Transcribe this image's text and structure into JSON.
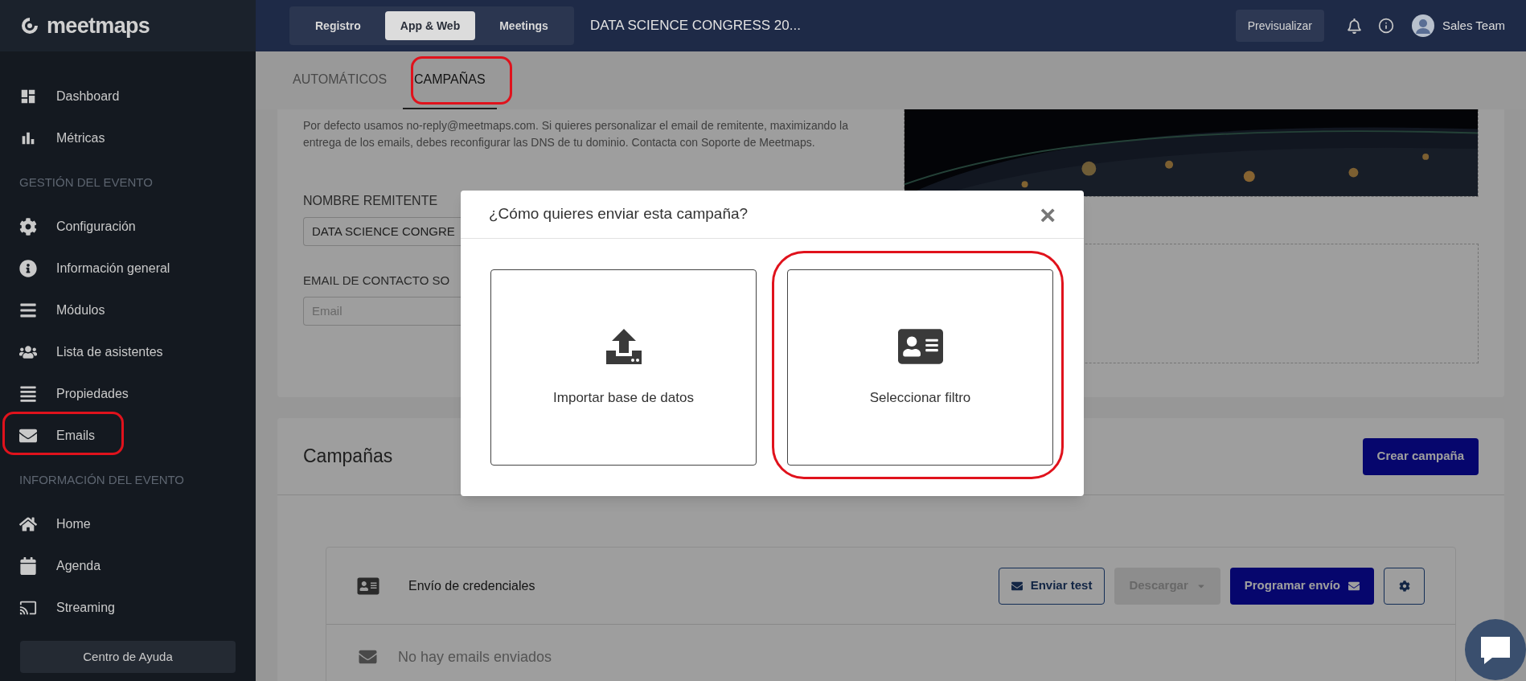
{
  "brand": {
    "name": "meetmaps"
  },
  "sidebar": {
    "items": [
      {
        "kind": "item",
        "label": "Dashboard"
      },
      {
        "kind": "item",
        "label": "Métricas"
      },
      {
        "kind": "header",
        "label": "GESTIÓN DEL EVENTO"
      },
      {
        "kind": "item",
        "label": "Configuración"
      },
      {
        "kind": "item",
        "label": "Información general"
      },
      {
        "kind": "item",
        "label": "Módulos"
      },
      {
        "kind": "item",
        "label": "Lista de asistentes"
      },
      {
        "kind": "item",
        "label": "Propiedades"
      },
      {
        "kind": "item",
        "label": "Emails"
      },
      {
        "kind": "header",
        "label": "INFORMACIÓN DEL EVENTO"
      },
      {
        "kind": "item",
        "label": "Home"
      },
      {
        "kind": "item",
        "label": "Agenda"
      },
      {
        "kind": "item",
        "label": "Streaming"
      }
    ],
    "help_button": "Centro de Ayuda"
  },
  "topbar": {
    "tabs": [
      {
        "label": "Registro",
        "selected": false
      },
      {
        "label": "App & Web",
        "selected": true
      },
      {
        "label": "Meetings",
        "selected": false
      }
    ],
    "event_title": "DATA SCIENCE CONGRESS 20...",
    "preview_button": "Previsualizar",
    "user": "Sales Team"
  },
  "subtabs": [
    {
      "label": "AUTOMÁTICOS",
      "selected": false
    },
    {
      "label": "CAMPAÑAS",
      "selected": true
    }
  ],
  "sender_card": {
    "note": "Por defecto usamos no-reply@meetmaps.com. Si quieres personalizar el email de remitente, maximizando la entrega de los emails, debes reconfigurar las DNS de tu dominio. Contacta con Soporte de Meetmaps.",
    "sender_name_label": "NOMBRE REMITENTE",
    "sender_name_value": "DATA SCIENCE CONGRE",
    "contact_label": "EMAIL DE CONTACTO SO",
    "contact_placeholder": "Email"
  },
  "campaigns": {
    "title": "Campañas",
    "create_button": "Crear campaña",
    "items": [
      {
        "name": "Envío de credenciales",
        "buttons": [
          {
            "kind": "outline",
            "label": "Enviar test",
            "disabled": false
          },
          {
            "kind": "dropdown",
            "label": "Descargar",
            "disabled": true
          },
          {
            "kind": "primary",
            "label": "Programar envío",
            "disabled": false
          },
          {
            "kind": "settings",
            "disabled": false
          }
        ],
        "empty_message": "No hay emails enviados"
      }
    ]
  },
  "modal": {
    "title": "¿Cómo quieres enviar esta campaña?",
    "close": "×",
    "options": [
      {
        "kind": "import",
        "label": "Importar base de datos"
      },
      {
        "kind": "filter",
        "label": "Seleccionar filtro"
      }
    ]
  }
}
